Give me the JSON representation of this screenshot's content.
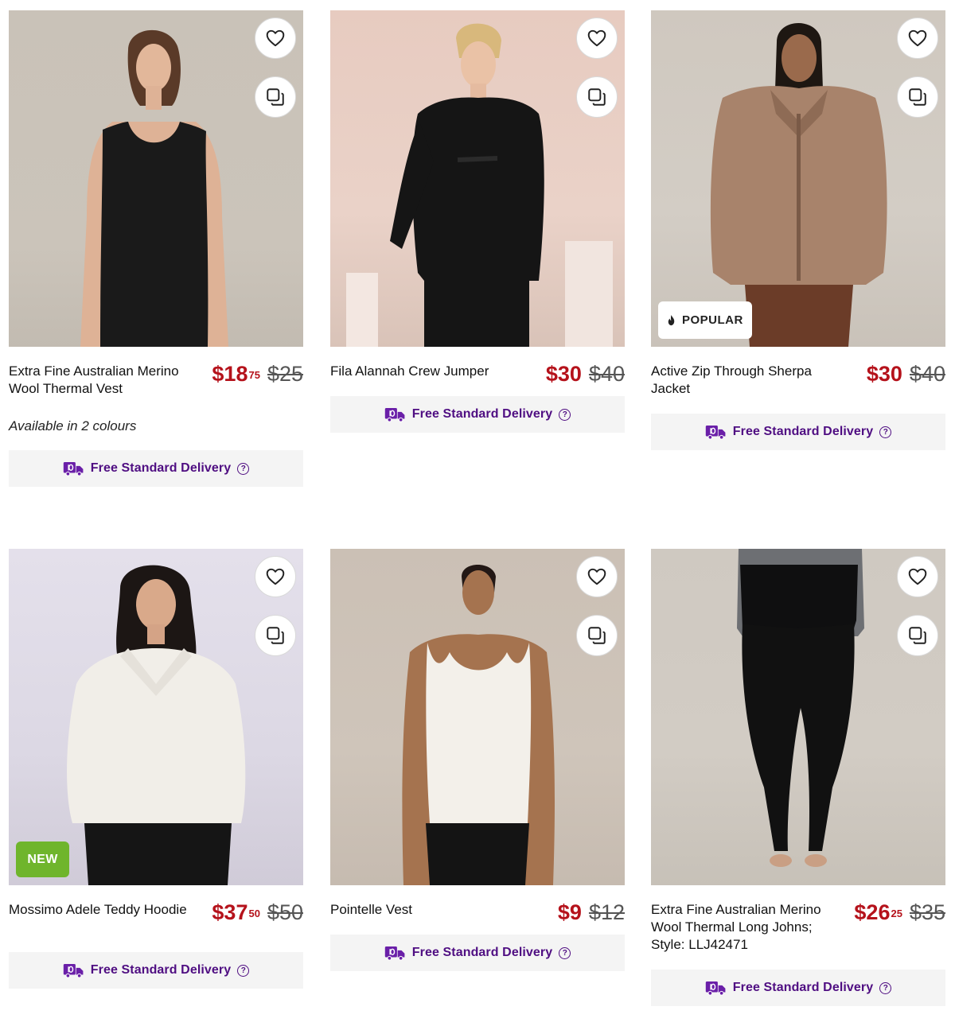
{
  "colors": {
    "sale_price": "#b5121b",
    "delivery_text": "#4f0e82",
    "new_badge": "#6fb52c"
  },
  "products": [
    {
      "name": "Extra Fine Australian Merino Wool Thermal Vest",
      "price_now_dollars": "$18",
      "price_now_cents": "75",
      "price_was": "$25",
      "availability": "Available in 2 colours",
      "delivery": "Free Standard Delivery"
    },
    {
      "name": "Fila Alannah Crew Jumper",
      "price_now_dollars": "$30",
      "price_now_cents": "",
      "price_was": "$40",
      "delivery": "Free Standard Delivery"
    },
    {
      "name": "Active Zip Through Sherpa Jacket",
      "price_now_dollars": "$30",
      "price_now_cents": "",
      "price_was": "$40",
      "badge": "POPULAR",
      "delivery": "Free Standard Delivery"
    },
    {
      "name": "Mossimo Adele Teddy Hoodie",
      "price_now_dollars": "$37",
      "price_now_cents": "50",
      "price_was": "$50",
      "badge": "NEW",
      "delivery": "Free Standard Delivery"
    },
    {
      "name": "Pointelle Vest",
      "price_now_dollars": "$9",
      "price_now_cents": "",
      "price_was": "$12",
      "delivery": "Free Standard Delivery"
    },
    {
      "name": "Extra Fine Australian Merino Wool Thermal Long Johns; Style: LLJ42471",
      "price_now_dollars": "$26",
      "price_now_cents": "25",
      "price_was": "$35",
      "delivery": "Free Standard Delivery"
    }
  ]
}
